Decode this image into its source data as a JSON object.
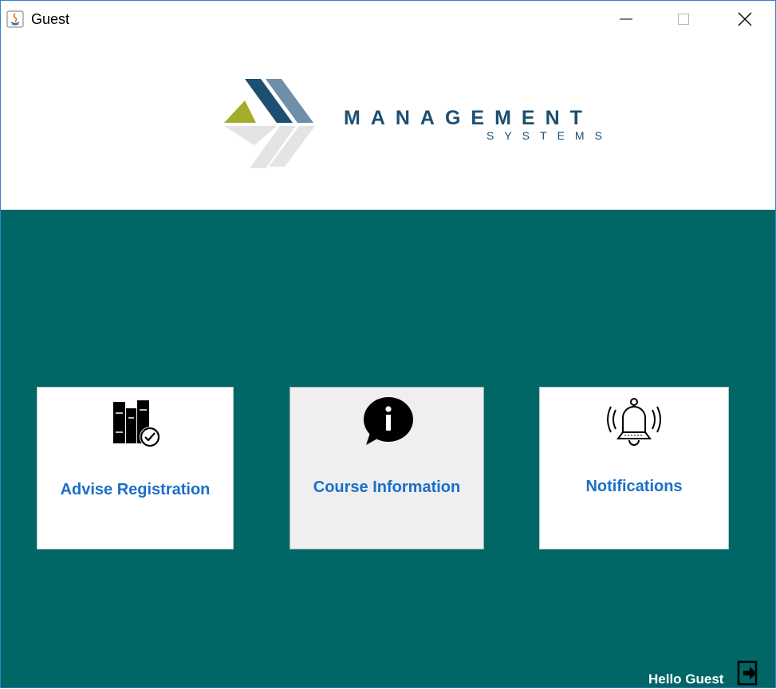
{
  "window": {
    "title": "Guest",
    "controls": [
      "minimize",
      "maximize",
      "close"
    ]
  },
  "header": {
    "brand_name": "MANAGEMENT",
    "brand_sub": "SYSTEMS"
  },
  "cards": [
    {
      "label": "Advise Registration",
      "icon": "books-check-icon"
    },
    {
      "label": "Course Information",
      "icon": "info-bubble-icon"
    },
    {
      "label": "Notifications",
      "icon": "bell-ringing-icon"
    }
  ],
  "footer": {
    "greeting": "Hello Guest",
    "logout_icon": "logout-icon"
  },
  "colors": {
    "main_bg": "#006666",
    "card_label": "#1a6fc8",
    "brand": "#1d4f72",
    "logo_green": "#a4ad2a",
    "logo_steel": "#5a7fa0",
    "logo_light": "#e4e4e4"
  }
}
